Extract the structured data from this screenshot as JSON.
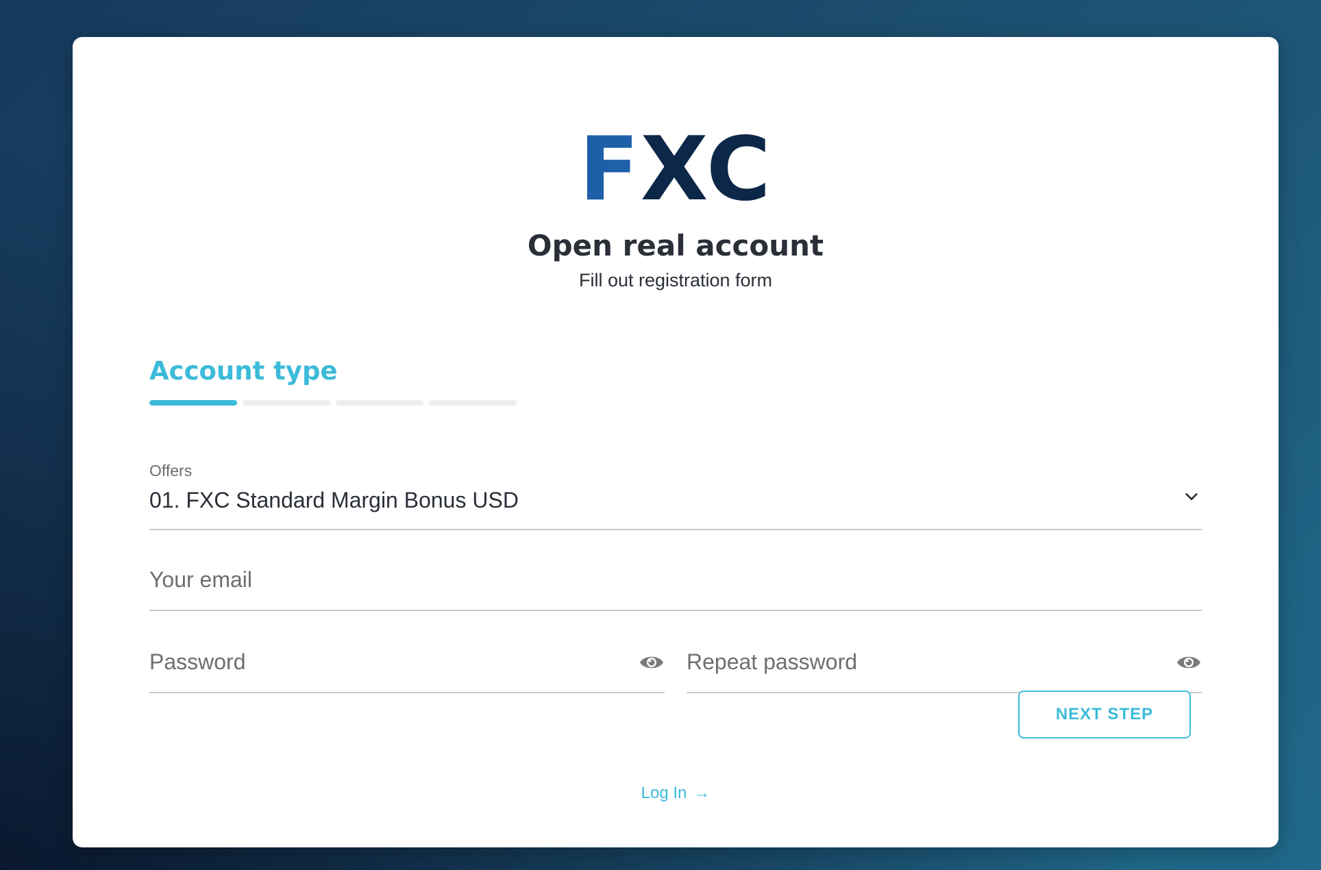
{
  "brand": {
    "logo_part1": "F",
    "logo_part2": "XC",
    "color_primary": "#1d5fa8",
    "color_dark": "#0c2748"
  },
  "header": {
    "title": "Open real account",
    "subtitle": "Fill out registration form"
  },
  "step": {
    "title": "Account type",
    "current": 1,
    "total": 4,
    "accent_color": "#3cbbd9"
  },
  "form": {
    "offers": {
      "label": "Offers",
      "value": "01. FXC Standard Margin Bonus USD"
    },
    "email": {
      "placeholder": "Your email"
    },
    "password": {
      "placeholder": "Password"
    },
    "repeat_password": {
      "placeholder": "Repeat password"
    },
    "next_label": "NEXT STEP"
  },
  "footer": {
    "login_label": "Log In",
    "login_arrow": "→"
  }
}
